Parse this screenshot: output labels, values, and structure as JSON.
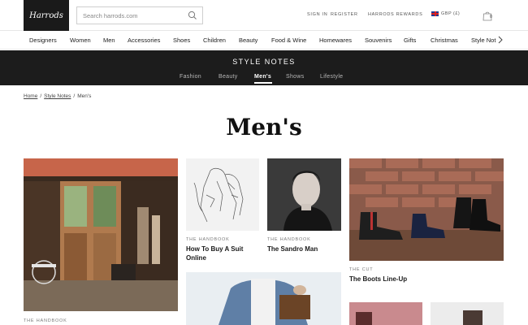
{
  "header": {
    "logo": "Harrods",
    "search_placeholder": "Search harrods.com",
    "sign_in": "SIGN IN",
    "register": "REGISTER",
    "rewards": "HARRODS REWARDS",
    "currency": "GBP (£)",
    "bag_count": "0"
  },
  "categories": [
    "Designers",
    "Women",
    "Men",
    "Accessories",
    "Shoes",
    "Children",
    "Beauty",
    "Food & Wine",
    "Homewares",
    "Souvenirs",
    "Gifts",
    "Christmas",
    "Style Not"
  ],
  "banner": {
    "title": "STYLE NOTES",
    "tabs": [
      "Fashion",
      "Beauty",
      "Men's",
      "Shows",
      "Lifestyle"
    ],
    "active_tab": "Men's"
  },
  "breadcrumb": [
    "Home",
    "Style Notes",
    "Men's"
  ],
  "page_title": "Men's",
  "cards": [
    {
      "tag": "THE HANDBOOK",
      "title": ""
    },
    {
      "tag": "THE HANDBOOK",
      "title": "How To Buy A Suit Online"
    },
    {
      "tag": "THE HANDBOOK",
      "title": "The Sandro Man"
    },
    {
      "tag": "THE CUT",
      "title": "The Boots Line-Up"
    }
  ]
}
